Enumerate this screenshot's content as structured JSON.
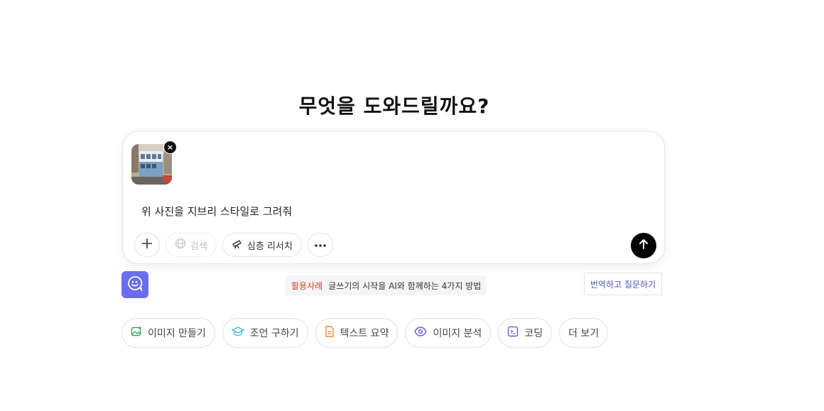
{
  "heading": "무엇을 도와드릴까요?",
  "composer": {
    "prompt_text": "위 사진을 지브리 스타일로 그려줘",
    "attachment_remove": "×",
    "tools": {
      "search_label": "검색",
      "deep_research_label": "심층 리서치"
    }
  },
  "usecase_banner": {
    "tag": "활용사례",
    "text": "글쓰기의 시작을 AI와 함께하는 4가지 방법"
  },
  "translate_button": "번역하고 질문하기",
  "chips": [
    {
      "label": "이미지 만들기",
      "icon": "image-create-icon",
      "color": "#3aa65a"
    },
    {
      "label": "조언 구하기",
      "icon": "graduation-cap-icon",
      "color": "#3bb8c7"
    },
    {
      "label": "텍스트 요약",
      "icon": "document-icon",
      "color": "#e58a3a"
    },
    {
      "label": "이미지 분석",
      "icon": "eye-icon",
      "color": "#5f63d6"
    },
    {
      "label": "코딩",
      "icon": "terminal-icon",
      "color": "#5f63d6"
    },
    {
      "label": "더 보기",
      "icon": "",
      "color": ""
    }
  ],
  "colors": {
    "accent": "#6b6df0",
    "send": "#000000",
    "usecase_tag": "#d2452b"
  }
}
